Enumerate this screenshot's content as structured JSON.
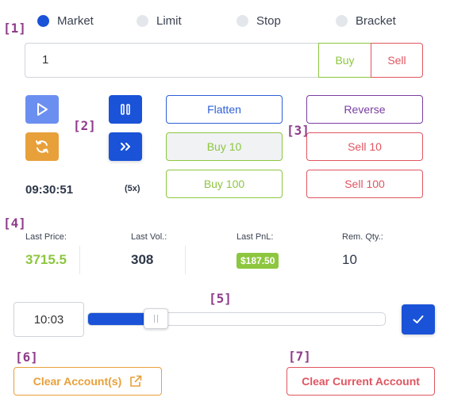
{
  "tags": [
    "[1]",
    "[2]",
    "[3]",
    "[4]",
    "[5]",
    "[6]",
    "[7]"
  ],
  "order_types": {
    "selected": "Market",
    "items": [
      "Market",
      "Limit",
      "Stop",
      "Bracket"
    ]
  },
  "quantity": {
    "value": "1",
    "buy_label": "Buy",
    "sell_label": "Sell"
  },
  "controls": {
    "play_icon": "play-icon",
    "pause_icon": "pause-icon",
    "refresh_icon": "refresh-icon",
    "fast_forward_icon": "fast-forward-icon",
    "clock": "09:30:51",
    "speed": "(5x)"
  },
  "actions": {
    "flatten": "Flatten",
    "buy10": "Buy 10",
    "buy100": "Buy 100",
    "reverse": "Reverse",
    "sell10": "Sell 10",
    "sell100": "Sell 100"
  },
  "stats": {
    "last_price_label": "Last Price:",
    "last_price": "3715.5",
    "last_vol_label": "Last Vol.:",
    "last_vol": "308",
    "last_pnl_label": "Last PnL:",
    "last_pnl": "$187.50",
    "rem_qty_label": "Rem. Qty.:",
    "rem_qty": "10"
  },
  "playback": {
    "time": "10:03",
    "position_fraction": 0.19
  },
  "clear": {
    "accounts": "Clear Account(s)",
    "current": "Clear Current Account"
  },
  "colors": {
    "primary": "#1a53d8",
    "buy": "#8dc63f",
    "sell": "#e05560",
    "warning": "#e8a03a",
    "reverse": "#7a3ea0"
  }
}
